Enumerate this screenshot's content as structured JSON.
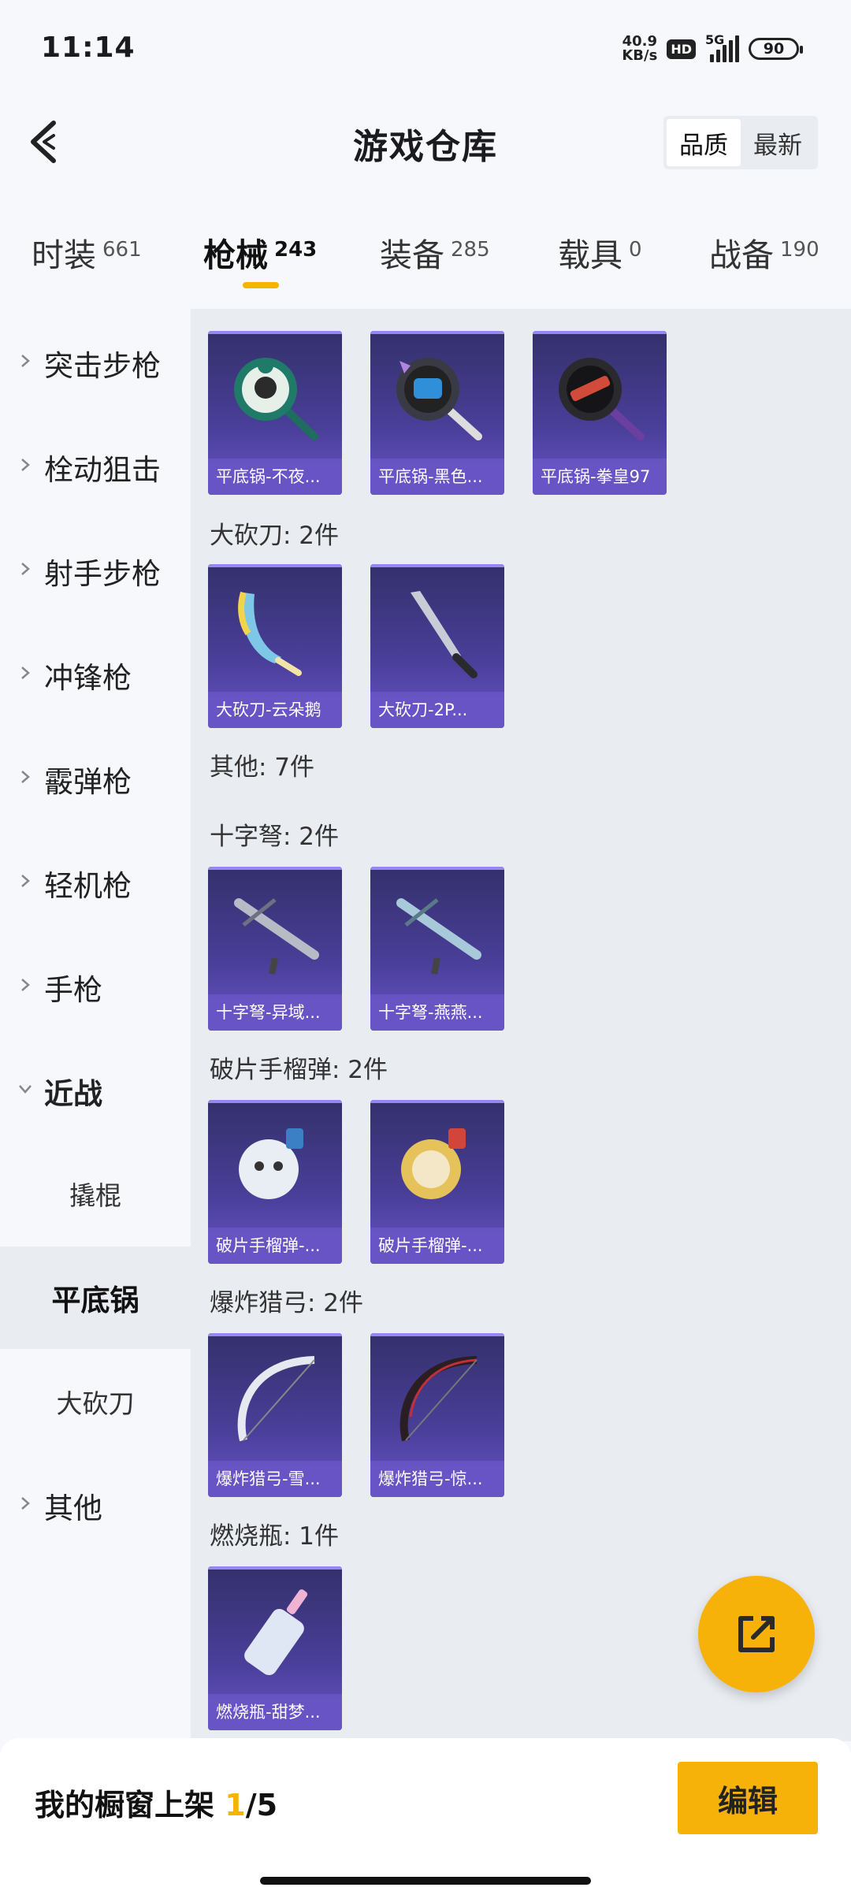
{
  "status": {
    "time": "11:14",
    "net_speed_value": "40.9",
    "net_speed_unit": "KB/s",
    "hd": "HD",
    "network": "5G",
    "battery": "90"
  },
  "header": {
    "title": "游戏仓库",
    "sort": {
      "quality": "品质",
      "latest": "最新"
    }
  },
  "tabs": [
    {
      "label": "时装",
      "count": "661"
    },
    {
      "label": "枪械",
      "count": "243"
    },
    {
      "label": "装备",
      "count": "285"
    },
    {
      "label": "载具",
      "count": "0"
    },
    {
      "label": "战备",
      "count": "190"
    }
  ],
  "sidebar": {
    "items": [
      "突击步枪",
      "栓动狙击",
      "射手步枪",
      "冲锋枪",
      "霰弹枪",
      "轻机枪",
      "手枪",
      "近战"
    ],
    "subitems": [
      "撬棍",
      "平底锅",
      "大砍刀"
    ],
    "other": "其他"
  },
  "sections": {
    "pan_cards": [
      "平底锅-不夜...",
      "平底锅-黑色...",
      "平底锅-拳皇97"
    ],
    "machete_title": "大砍刀: 2件",
    "machete_cards": [
      "大砍刀-云朵鹅",
      "大砍刀-2P..."
    ],
    "other_title": "其他: 7件",
    "crossbow_title": "十字弩: 2件",
    "crossbow_cards": [
      "十字弩-异域...",
      "十字弩-燕燕..."
    ],
    "grenade_title": "破片手榴弹: 2件",
    "grenade_cards": [
      "破片手榴弹-...",
      "破片手榴弹-..."
    ],
    "bow_title": "爆炸猎弓: 2件",
    "bow_cards": [
      "爆炸猎弓-雪...",
      "爆炸猎弓-惊..."
    ],
    "molotov_title": "燃烧瓶: 1件",
    "molotov_cards": [
      "燃烧瓶-甜梦..."
    ]
  },
  "bottom": {
    "showcase_label": "我的橱窗上架",
    "current": "1",
    "total": "/5",
    "edit_label": "编辑"
  },
  "colors": {
    "accent": "#f5b400",
    "card_purple": "#4a3f9a"
  }
}
